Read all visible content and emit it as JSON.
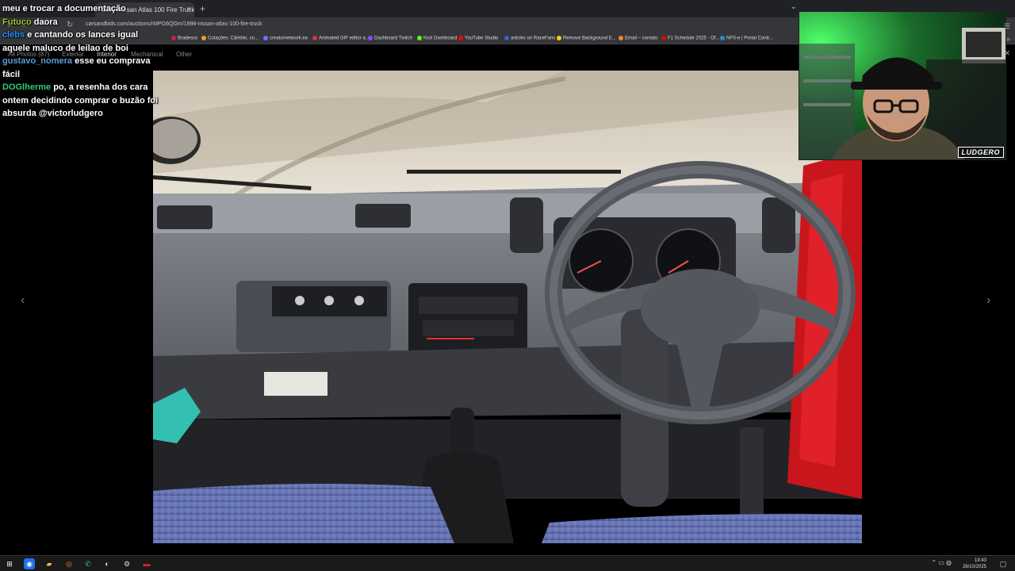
{
  "browser": {
    "active_tab_title": "1998 Nissan Atlas 100 Fire Truck",
    "url": "carsandbids.com/auctions/rMPG6QGm/1998-nissan-atlas-100-fire-truck",
    "new_tab_label": "+",
    "close_tab_label": "×"
  },
  "bookmarks": [
    {
      "label": "Bradesco",
      "color": "#cc2244"
    },
    {
      "label": "Cotações: Câmbio, co...",
      "color": "#f0a020"
    },
    {
      "label": "creatornetwork.ea",
      "color": "#6677ff"
    },
    {
      "label": "Animated GIF editor a...",
      "color": "#dd3333"
    },
    {
      "label": "Dashboard Twitch",
      "color": "#9146ff"
    },
    {
      "label": "Kick Dashboard",
      "color": "#53fc18"
    },
    {
      "label": "YouTube Studio",
      "color": "#ff0000"
    },
    {
      "label": "articles on RaceFans",
      "color": "#3366cc"
    },
    {
      "label": "Remove Background E...",
      "color": "#ffcc00"
    },
    {
      "label": "Email – contato",
      "color": "#ee8822"
    },
    {
      "label": "F1 Schedule 2025 - Of...",
      "color": "#e10600"
    },
    {
      "label": "NFS-e | Portal Contr...",
      "color": "#3388cc"
    }
  ],
  "gallery": {
    "tabs": [
      "All Photos (87)",
      "Exterior",
      "Interior",
      "Mechanical",
      "Other"
    ],
    "active_tab": "Interior",
    "prev_arrow": "‹",
    "next_arrow": "›"
  },
  "chat": [
    {
      "user": "",
      "text": "meu e trocar a documentação",
      "color": "#ffffff"
    },
    {
      "user": "Futuco",
      "text": "daora",
      "color": "#9acd32"
    },
    {
      "user": "clebs",
      "text": "e cantando os lances igual aquele maluco de leilao de boi",
      "color": "#1e90ff"
    },
    {
      "user": "gustavo_nomera",
      "text": "esse eu comprava fácil",
      "color": "#5b9bd5"
    },
    {
      "user": "DOGlherme",
      "text": "po, a resenha dos cara ontem decidindo comprar o buzão foi absurda @victorludgero",
      "color": "#2ecc71"
    }
  ],
  "webcam": {
    "logo": "LUDGERO"
  },
  "taskbar": {
    "time": "19:43",
    "date": "28/10/2025"
  },
  "colors": {
    "accent": "#e82127"
  }
}
